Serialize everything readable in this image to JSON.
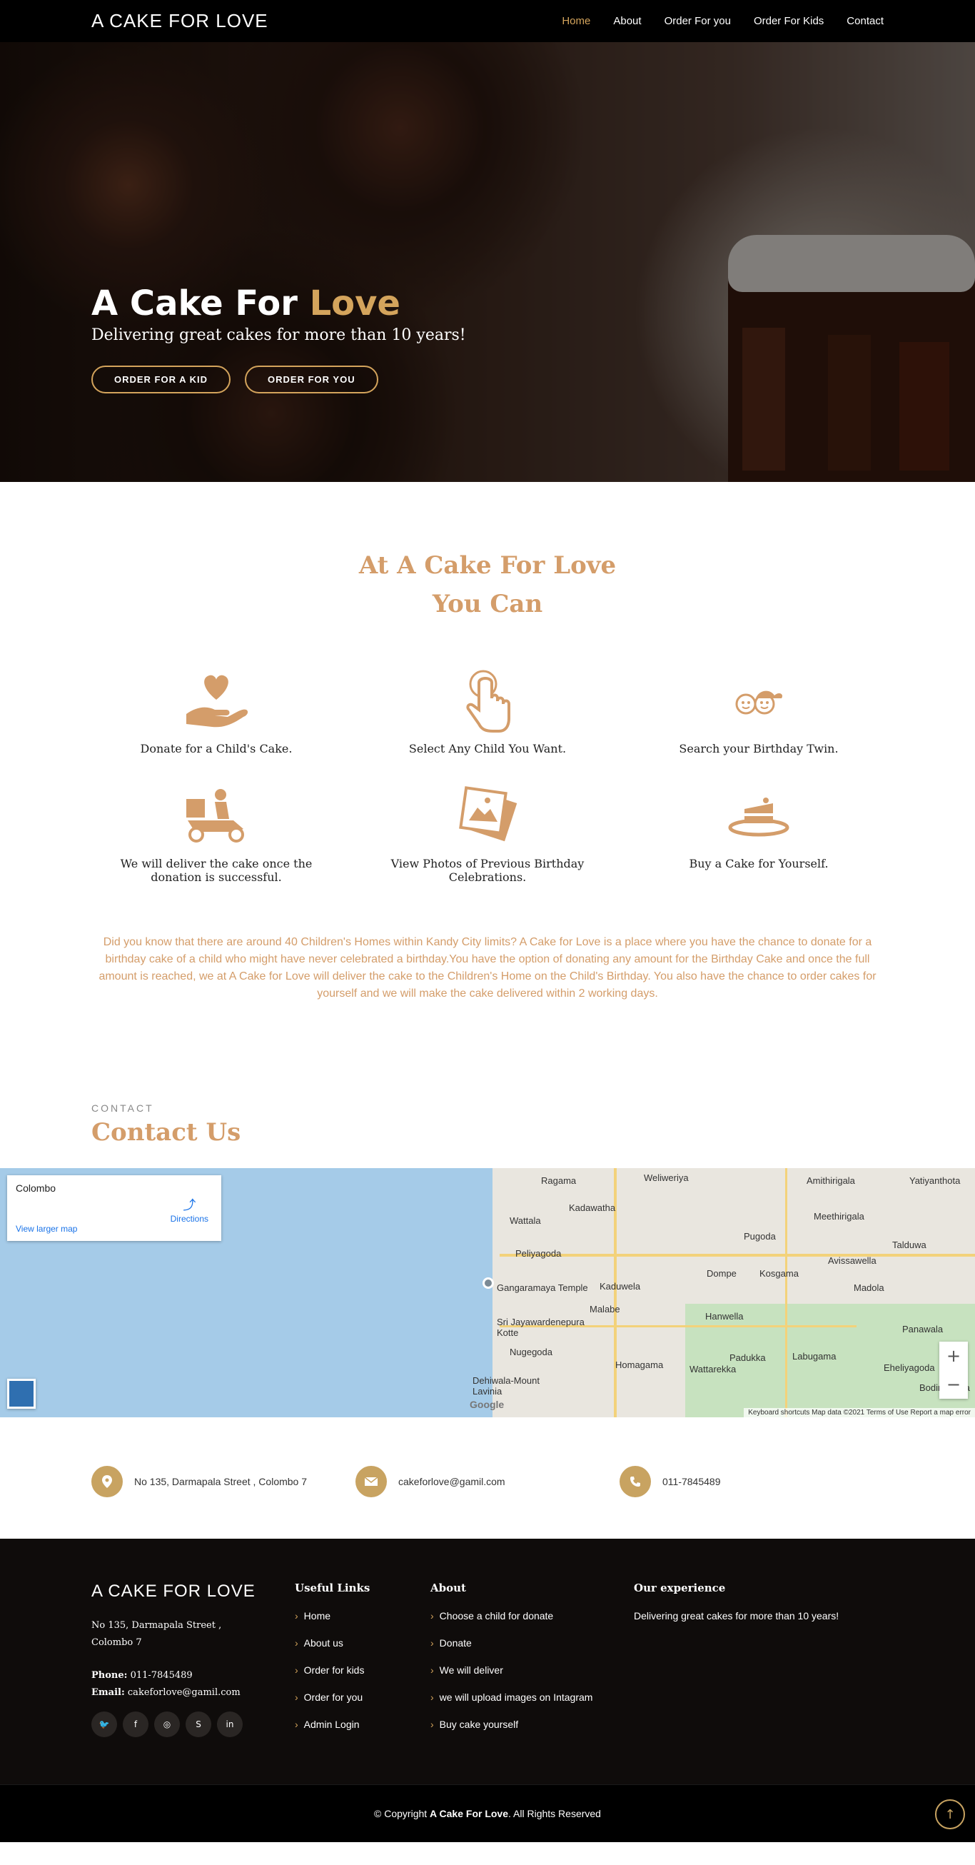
{
  "header": {
    "logo": "A CAKE FOR LOVE",
    "nav": [
      "Home",
      "About",
      "Order For you",
      "Order For Kids",
      "Contact"
    ]
  },
  "hero": {
    "title_main": "A Cake For ",
    "title_accent": "Love",
    "subtitle": "Delivering great cakes for more than 10 years!",
    "btn_kid": "ORDER FOR A KID",
    "btn_you": "ORDER FOR YOU"
  },
  "services": {
    "heading_line1": "At A Cake For Love",
    "heading_line2": "You Can",
    "items": [
      {
        "label": "Donate for a Child's Cake.",
        "icon": "heart-hand-icon"
      },
      {
        "label": "Select Any Child You Want.",
        "icon": "pointing-hand-icon"
      },
      {
        "label": "Search your Birthday Twin.",
        "icon": "twins-icon"
      },
      {
        "label": "We will deliver the cake once the donation is successful.",
        "icon": "delivery-scooter-icon"
      },
      {
        "label": "View Photos of Previous Birthday Celebrations.",
        "icon": "photos-icon"
      },
      {
        "label": "Buy a Cake for Yourself.",
        "icon": "cake-slice-icon"
      }
    ],
    "paragraph": "Did you know that there are around 40 Children's Homes within Kandy City limits? A Cake for Love is a place where you have the chance to donate for a birthday cake of a child who might have never celebrated a birthday.You have the option of donating any amount for the Birthday Cake and once the full amount is reached, we at A Cake for Love will deliver the cake to the Children's Home on the Child's Birthday. You also have the chance to order cakes for yourself and we will make the cake delivered within 2 working days."
  },
  "contact": {
    "kicker": "CONTACT",
    "title": "Contact Us",
    "map": {
      "card_title": "Colombo",
      "directions": "Directions",
      "larger_map": "View larger map",
      "places": [
        "Ragama",
        "Weliweriya",
        "Wattala",
        "Peliyagoda",
        "Gangaramaya Temple",
        "Malabe",
        "Sri Jayawardenepura Kotte",
        "Nugegoda",
        "Dehiwala-Mount Lavinia",
        "Homagama",
        "Kaduwela",
        "Dompe",
        "Kosgama",
        "Hanwella",
        "Padukka",
        "Labugama",
        "Eheliyagoda",
        "Amithirigala",
        "Yatiyanthota",
        "Pugoda",
        "Avissawella",
        "Madola",
        "Meethirigala",
        "Kadawatha",
        "Wattarekka",
        "Panawala",
        "Bodimaluwa",
        "Talduwa"
      ],
      "attribution": "Keyboard shortcuts   Map data ©2021   Terms of Use   Report a map error",
      "zoom_in": "+",
      "zoom_out": "−"
    },
    "address": "No 135, Darmapala Street , Colombo 7",
    "email": "cakeforlove@gamil.com",
    "phone": "011-7845489"
  },
  "footer": {
    "logo": "A CAKE FOR LOVE",
    "address_line1": "No 135, Darmapala Street ,",
    "address_line2": "Colombo 7",
    "phone_label": "Phone:",
    "phone": "011-7845489",
    "email_label": "Email:",
    "email": "cakeforlove@gamil.com",
    "useful_links_title": "Useful Links",
    "useful_links": [
      "Home",
      "About us",
      "Order for kids",
      "Order for you",
      "Admin Login"
    ],
    "about_title": "About",
    "about_links": [
      "Choose a child for donate",
      "Donate",
      "We will deliver",
      "we will upload images on Intagram",
      "Buy cake yourself"
    ],
    "experience_title": "Our experience",
    "experience_text": "Delivering great cakes for more than 10 years!",
    "copyright_pre": "© Copyright ",
    "copyright_brand": "A Cake For Love",
    "copyright_post": ". All Rights Reserved"
  },
  "colors": {
    "accent": "#d4a45c",
    "heading": "#d49d6a",
    "footer_bg": "#0f0c0b"
  }
}
